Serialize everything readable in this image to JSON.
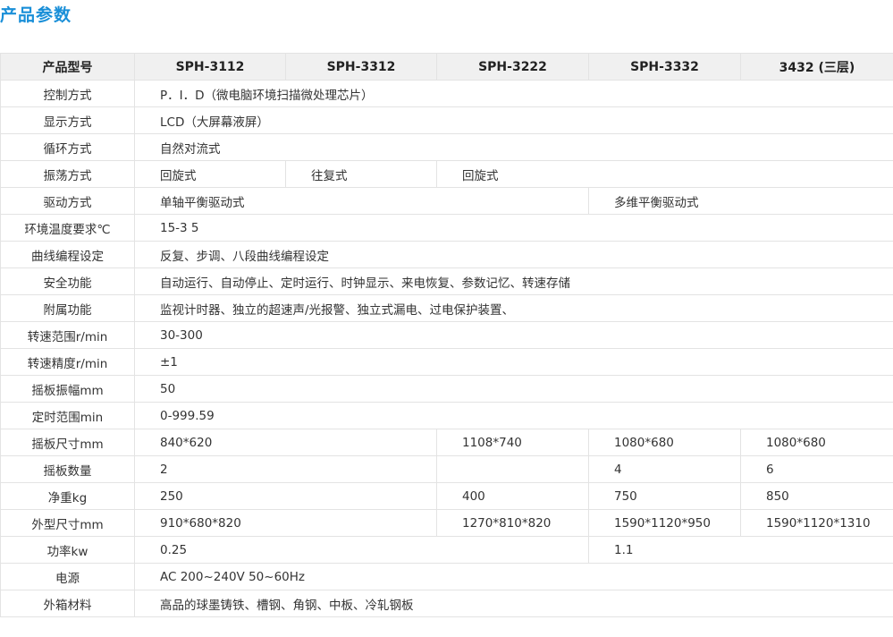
{
  "page_title": "产品参数",
  "header": {
    "label": "产品型号",
    "models": [
      "SPH-3112",
      "SPH-3312",
      "SPH-3222",
      "SPH-3332",
      "3432 (三层)"
    ]
  },
  "rows": {
    "control": {
      "label": "控制方式",
      "value": "P．I．D（微电脑环境扫描微处理芯片）"
    },
    "display": {
      "label": "显示方式",
      "value": "LCD（大屏幕液屏）"
    },
    "circulation": {
      "label": "循环方式",
      "value": "自然对流式"
    },
    "oscillation": {
      "label": "振荡方式",
      "v1": "回旋式",
      "v2": "往复式",
      "v3": "回旋式"
    },
    "drive": {
      "label": "驱动方式",
      "v1": "单轴平衡驱动式",
      "v2": "多维平衡驱动式"
    },
    "env_temp": {
      "label": "环境温度要求℃",
      "value": "15-3 5"
    },
    "curve": {
      "label": "曲线编程设定",
      "value": "反复、步调、八段曲线编程设定"
    },
    "safety": {
      "label": "安全功能",
      "value": "自动运行、自动停止、定时运行、时钟显示、来电恢复、参数记忆、转速存储"
    },
    "accessory": {
      "label": "附属功能",
      "value": "监视计时器、独立的超速声/光报警、独立式漏电、过电保护装置、"
    },
    "speed_range": {
      "label": "转速范围r/min",
      "value": "30-300"
    },
    "speed_precision": {
      "label": "转速精度r/min",
      "value": "±1"
    },
    "amplitude": {
      "label": "摇板振幅mm",
      "value": "50"
    },
    "timer_range": {
      "label": "定时范围min",
      "value": "0-999.59"
    },
    "board_size": {
      "label": "摇板尺寸mm",
      "v1": "840*620",
      "v2": "1108*740",
      "v3": "1080*680",
      "v4": "1080*680"
    },
    "board_count": {
      "label": "摇板数量",
      "v1": "2",
      "v2": "",
      "v3": "4",
      "v4": "6"
    },
    "net_weight": {
      "label": "净重kg",
      "v1": "250",
      "v2": "400",
      "v3": "750",
      "v4": "850"
    },
    "outer_size": {
      "label": "外型尺寸mm",
      "v1": "910*680*820",
      "v2": "1270*810*820",
      "v3": "1590*1120*950",
      "v4": "1590*1120*1310"
    },
    "power": {
      "label": "功率kw",
      "v1": "0.25",
      "v2": "1.1"
    },
    "supply": {
      "label": "电源",
      "value": "AC 200~240V 50~60Hz"
    },
    "material": {
      "label": "外箱材料",
      "value": "高品的球墨铸铁、槽钢、角钢、中板、冷轧钢板"
    }
  }
}
